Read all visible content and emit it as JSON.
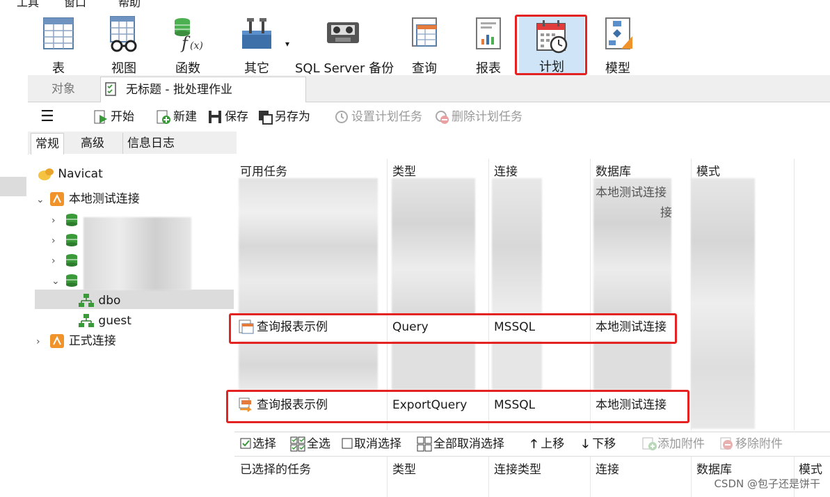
{
  "menu": {
    "tools": "工具",
    "window": "窗口",
    "help": "帮助"
  },
  "ribbon": {
    "table": "表",
    "view": "视图",
    "function": "函数",
    "other": "其它",
    "sqlbackup": "SQL Server 备份",
    "query": "查询",
    "report": "报表",
    "schedule": "计划",
    "model": "模型"
  },
  "tabs": {
    "objects": "对象",
    "batch": "无标题 - 批处理作业"
  },
  "toolbar": {
    "start": "开始",
    "new": "新建",
    "save": "保存",
    "saveas": "另存为",
    "set_task": "设置计划任务",
    "delete_task": "删除计划任务"
  },
  "subtabs": {
    "general": "常规",
    "advanced": "高级",
    "log": "信息日志"
  },
  "tree": {
    "root": "Navicat",
    "local": "本地测试连接",
    "dbo": "dbo",
    "guest": "guest",
    "prod": "正式连接"
  },
  "grid": {
    "headers": {
      "task": "可用任务",
      "type": "类型",
      "conn": "连接",
      "db": "数据库",
      "schema": "模式"
    },
    "row1": {
      "task": "查询报表示例",
      "type": "Query",
      "conn": "MSSQL",
      "db": "本地测试连接"
    },
    "row2": {
      "task": "查询报表示例",
      "type": "ExportQuery",
      "conn": "MSSQL",
      "db": "本地测试连接"
    },
    "partial": {
      "db_a": "本地测试连接",
      "db_b": "接"
    }
  },
  "bottom_toolbar": {
    "select": "选择",
    "select_all": "全选",
    "deselect": "取消选择",
    "deselect_all": "全部取消选择",
    "move_up": "上移",
    "move_down": "下移",
    "add_attach": "添加附件",
    "remove_attach": "移除附件"
  },
  "selected_grid": {
    "headers": {
      "task": "已选择的任务",
      "type": "类型",
      "conn_type": "连接类型",
      "conn": "连接",
      "db": "数据库",
      "schema": "模式"
    }
  },
  "watermark": "CSDN @包子还是饼干",
  "colors": {
    "highlight_red": "#e52222",
    "active_bg": "#cfe4f7",
    "green": "#3a9a3a",
    "orange": "#f0932b"
  }
}
